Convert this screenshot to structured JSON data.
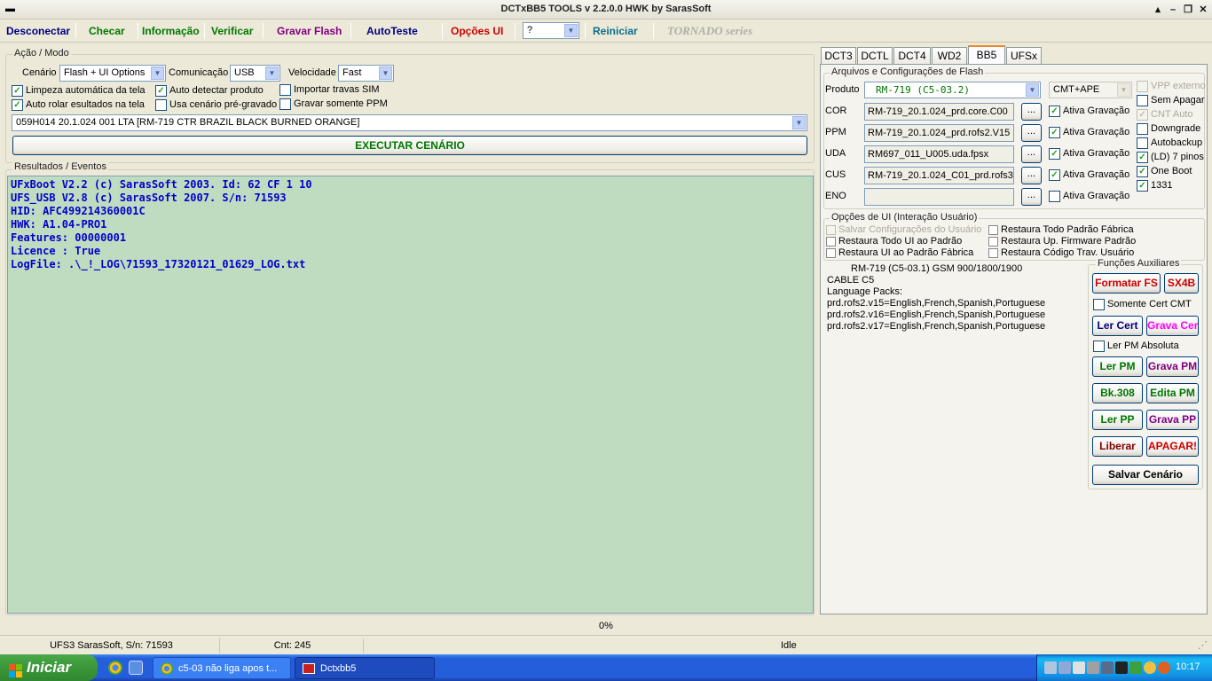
{
  "window": {
    "title": "DCTxBB5 TOOLS v 2.2.0.0 HWK by SarasSoft"
  },
  "toolbar": {
    "disconnect": "Desconectar",
    "check": "Checar",
    "info": "Informação",
    "verify": "Verificar",
    "flash": "Gravar Flash",
    "autotest": "AutoTeste",
    "ui_options": "Opções UI",
    "selector_value": "?",
    "restart": "Reiniciar",
    "tornado": "TORNADO series"
  },
  "action": {
    "group_label": "Ação / Modo",
    "scenario_label": "Cenário",
    "scenario_value": "Flash + UI Options",
    "comm_label": "Comunicação",
    "comm_value": "USB",
    "speed_label": "Velocidade",
    "speed_value": "Fast",
    "options": [
      {
        "label": "Limpeza automática da tela",
        "checked": true
      },
      {
        "label": "Auto detectar produto",
        "checked": true
      },
      {
        "label": "Importar travas SIM",
        "checked": false
      },
      {
        "label": "Auto rolar esultados na tela",
        "checked": true
      },
      {
        "label": "Usa cenário pré-gravado",
        "checked": false
      },
      {
        "label": "Gravar somente PPM",
        "checked": false
      }
    ],
    "product_line": "059H014 20.1.024 001 LTA [RM-719 CTR BRAZIL BLACK BURNED ORANGE]",
    "execute": "EXECUTAR CENÁRIO"
  },
  "results": {
    "label": "Resultados / Eventos",
    "lines": [
      "UFxBoot V2.2 (c) SarasSoft 2003. Id: 62 CF 1 10",
      "UFS_USB V2.8 (c) SarasSoft 2007. S/n: 71593",
      "HID: AFC499214360001C",
      "HWK: A1.04-PRO1",
      "Features: 00000001",
      "Licence : True",
      "LogFile: .\\_!_LOG\\71593_17320121_01629_LOG.txt"
    ]
  },
  "tabs": [
    "DCT3",
    "DCTL",
    "DCT4",
    "WD2",
    "BB5",
    "UFSx"
  ],
  "flash": {
    "group_label": "Arquivos e Configurações de Flash",
    "product_label": "Produto",
    "product_value": "RM-719 (C5-03.2)",
    "mode_value": "CMT+APE",
    "files": [
      {
        "label": "COR",
        "value": "RM-719_20.1.024_prd.core.C00",
        "browse": "...",
        "ativa": "Ativa Gravação",
        "checked": true
      },
      {
        "label": "PPM",
        "value": "RM-719_20.1.024_prd.rofs2.V15",
        "browse": "...",
        "ativa": "Ativa Gravação",
        "checked": true
      },
      {
        "label": "UDA",
        "value": "RM697_011_U005.uda.fpsx",
        "browse": "...",
        "ativa": "Ativa Gravação",
        "checked": true
      },
      {
        "label": "CUS",
        "value": "RM-719_20.1.024_C01_prd.rofs3.",
        "browse": "...",
        "ativa": "Ativa Gravação",
        "checked": true
      },
      {
        "label": "ENO",
        "value": "",
        "browse": "...",
        "ativa": "Ativa Gravação",
        "checked": false
      }
    ],
    "right_options": [
      {
        "label": "VPP externo",
        "checked": false,
        "disabled": true
      },
      {
        "label": "Sem Apagar",
        "checked": false,
        "disabled": false
      },
      {
        "label": "CNT Auto",
        "checked": true,
        "disabled": true
      },
      {
        "label": "Downgrade",
        "checked": false,
        "disabled": false
      },
      {
        "label": "Autobackup",
        "checked": false,
        "disabled": false
      },
      {
        "label": "(LD) 7 pinos",
        "checked": true,
        "disabled": false
      },
      {
        "label": "One Boot",
        "checked": true,
        "disabled": false
      },
      {
        "label": "1331",
        "checked": true,
        "disabled": false
      }
    ]
  },
  "ui_opts": {
    "group_label": "Opções de UI (Interação Usuário)",
    "options": [
      {
        "label": "Salvar Configurações do Usuário",
        "disabled": true
      },
      {
        "label": "Restaura Todo Padrão Fábrica",
        "disabled": false
      },
      {
        "label": "Restaura Todo UI ao Padrão",
        "disabled": false
      },
      {
        "label": "Restaura Up. Firmware Padrão",
        "disabled": false
      },
      {
        "label": "Restaura UI ao Padrão Fábrica",
        "disabled": false
      },
      {
        "label": "Restaura Código Trav. Usuário",
        "disabled": false
      }
    ]
  },
  "product_info": {
    "lines": [
      "RM-719 (C5-03.1) GSM 900/1800/1900",
      "CABLE C5",
      "Language Packs:",
      "prd.rofs2.v15=English,French,Spanish,Portuguese",
      "prd.rofs2.v16=English,French,Spanish,Portuguese",
      "prd.rofs2.v17=English,French,Spanish,Portuguese"
    ]
  },
  "aux": {
    "group_label": "Funções Auxiliares",
    "format_fs": "Formatar FS",
    "sx4b": "SX4B",
    "only_cert_cmt": "Somente Cert CMT",
    "read_cert": "Ler Cert",
    "write_cert": "Grava Cert",
    "pm_absolute": "Ler PM Absoluta",
    "read_pm": "Ler PM",
    "write_pm": "Grava PM",
    "bk308": "Bk.308",
    "edit_pm": "Edita PM",
    "read_pp": "Ler PP",
    "write_pp": "Grava PP",
    "release": "Liberar",
    "erase": "APAGAR!",
    "save_scenario": "Salvar Cenário"
  },
  "progress": {
    "text": "0%"
  },
  "status": {
    "device": "UFS3 SarasSoft, S/n: 71593",
    "count": "Cnt: 245",
    "state": "Idle"
  },
  "taskbar": {
    "start": "Iniciar",
    "task1": "c5-03 não liga apos t...",
    "task2": "Dctxbb5",
    "clock": "10:17"
  },
  "colors": {
    "green": "#007700",
    "purple": "#800080",
    "red": "#cc0000",
    "navy": "#000080",
    "magenta": "#ff00ff",
    "log_bg": "#c0dcc0",
    "log_text": "#0000cc"
  }
}
